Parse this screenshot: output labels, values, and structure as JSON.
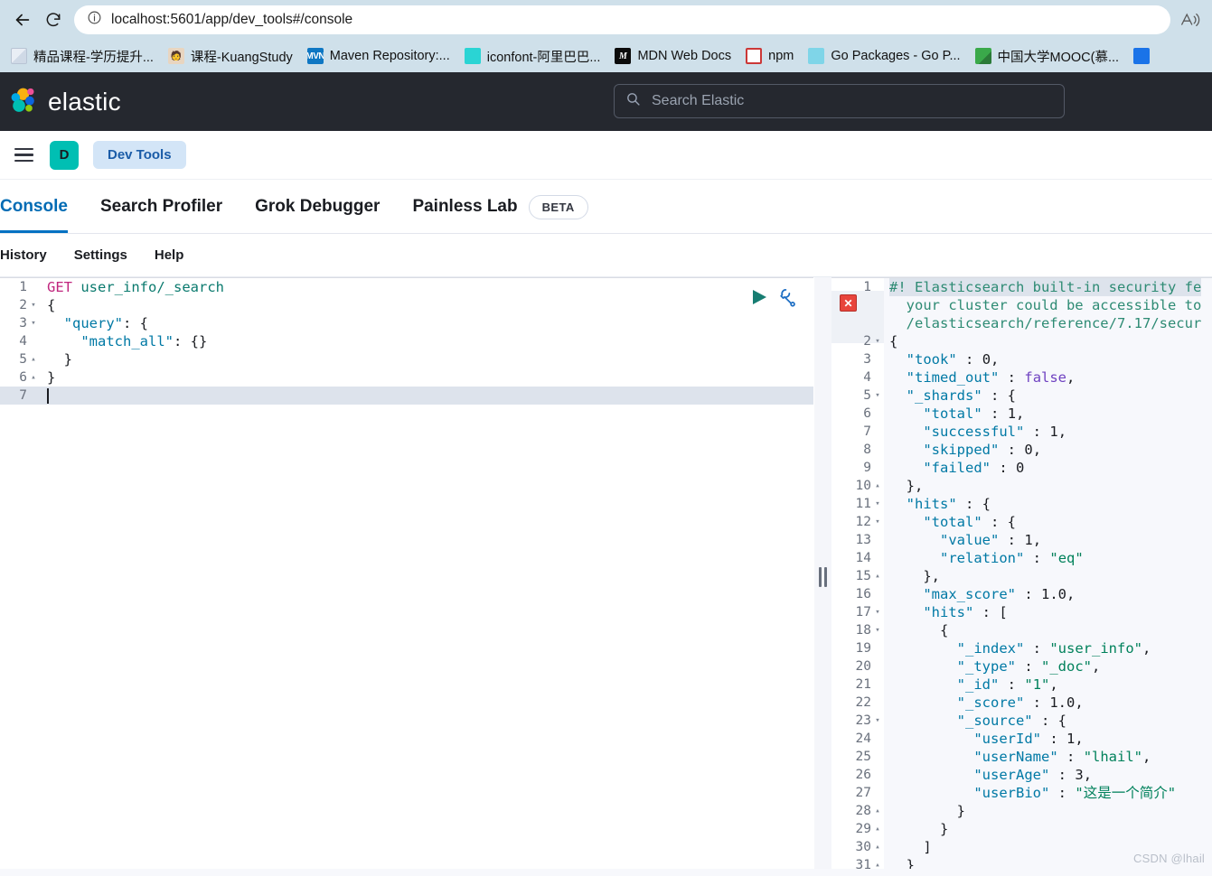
{
  "browser": {
    "back_label": "Back",
    "reload_label": "Reload",
    "url": "localhost:5601/app/dev_tools#/console",
    "read_aloud_label": "Read aloud",
    "bookmarks": [
      {
        "label": "精品课程-学历提升...",
        "icon": "document-icon",
        "style": "fav-doc"
      },
      {
        "label": "课程-KuangStudy",
        "icon": "avatar-icon",
        "style": "fav-kuang"
      },
      {
        "label": "Maven Repository:...",
        "icon": "maven-icon",
        "style": "fav-mvn",
        "glyph": "MVN"
      },
      {
        "label": "iconfont-阿里巴巴...",
        "icon": "iconfont-icon",
        "style": "fav-icon"
      },
      {
        "label": "MDN Web Docs",
        "icon": "mdn-icon",
        "style": "fav-mdn",
        "glyph": "M"
      },
      {
        "label": "npm",
        "icon": "npm-icon",
        "style": "fav-npm",
        "glyph": "n"
      },
      {
        "label": "Go Packages - Go P...",
        "icon": "go-icon",
        "style": "fav-go"
      },
      {
        "label": "中国大学MOOC(慕...",
        "icon": "mooc-icon",
        "style": "fav-mooc"
      },
      {
        "label": "",
        "icon": "generic-icon",
        "style": "fav-blue"
      }
    ]
  },
  "header": {
    "brand": "elastic",
    "search_placeholder": "Search Elastic",
    "search_icon": "search-icon"
  },
  "appnav": {
    "menu_icon": "hamburger-menu-icon",
    "avatar_initial": "D",
    "breadcrumb": "Dev Tools"
  },
  "tabs": [
    {
      "label": "Console",
      "active": true
    },
    {
      "label": "Search Profiler",
      "active": false
    },
    {
      "label": "Grok Debugger",
      "active": false
    },
    {
      "label": "Painless Lab",
      "active": false,
      "badge": "BETA"
    }
  ],
  "subnav": [
    {
      "label": "History"
    },
    {
      "label": "Settings"
    },
    {
      "label": "Help"
    }
  ],
  "editor": {
    "play_label": "Click to send request",
    "wrench_label": "Open documentation",
    "lines": [
      {
        "n": "1",
        "fold": "",
        "html": "<span class='k-method'>GET</span> <span class='k-url'>user_info/_search</span>",
        "current": false
      },
      {
        "n": "2",
        "fold": "▾",
        "html": "<span class='k-punct'>{</span>",
        "current": false
      },
      {
        "n": "3",
        "fold": "▾",
        "html": "  <span class='k-key'>\"query\"</span><span class='k-punct'>: {</span>",
        "current": false
      },
      {
        "n": "4",
        "fold": "",
        "html": "    <span class='k-key'>\"match_all\"</span><span class='k-punct'>: {}</span>",
        "current": false
      },
      {
        "n": "5",
        "fold": "▴",
        "html": "  <span class='k-punct'>}</span>",
        "current": false
      },
      {
        "n": "6",
        "fold": "▴",
        "html": "<span class='k-punct'>}</span>",
        "current": false
      },
      {
        "n": "7",
        "fold": "",
        "html": "<span class='caret'></span>",
        "current": true
      }
    ]
  },
  "response": {
    "error_marker": "error-x-icon",
    "lines": [
      {
        "n": "1",
        "fold": "",
        "html": "<span class='k-comment'>#! Elasticsearch built-in security fe</span>",
        "hl": true
      },
      {
        "n": "",
        "fold": "",
        "html": "  <span class='k-comment'>your cluster could be accessible to</span>",
        "hl": false
      },
      {
        "n": "",
        "fold": "",
        "html": "  <span class='k-comment'>/elasticsearch/reference/7.17/secur</span>",
        "hl": false
      },
      {
        "n": "2",
        "fold": "▾",
        "html": "<span class='k-punct'>{</span>",
        "hl": false
      },
      {
        "n": "3",
        "fold": "",
        "html": "  <span class='k-key'>\"took\"</span> <span class='k-punct'>:</span> <span class='k-num'>0</span><span class='k-punct'>,</span>",
        "hl": false
      },
      {
        "n": "4",
        "fold": "",
        "html": "  <span class='k-key'>\"timed_out\"</span> <span class='k-punct'>:</span> <span class='k-bool'>false</span><span class='k-punct'>,</span>",
        "hl": false
      },
      {
        "n": "5",
        "fold": "▾",
        "html": "  <span class='k-key'>\"_shards\"</span> <span class='k-punct'>: {</span>",
        "hl": false
      },
      {
        "n": "6",
        "fold": "",
        "html": "    <span class='k-key'>\"total\"</span> <span class='k-punct'>:</span> <span class='k-num'>1</span><span class='k-punct'>,</span>",
        "hl": false
      },
      {
        "n": "7",
        "fold": "",
        "html": "    <span class='k-key'>\"successful\"</span> <span class='k-punct'>:</span> <span class='k-num'>1</span><span class='k-punct'>,</span>",
        "hl": false
      },
      {
        "n": "8",
        "fold": "",
        "html": "    <span class='k-key'>\"skipped\"</span> <span class='k-punct'>:</span> <span class='k-num'>0</span><span class='k-punct'>,</span>",
        "hl": false
      },
      {
        "n": "9",
        "fold": "",
        "html": "    <span class='k-key'>\"failed\"</span> <span class='k-punct'>:</span> <span class='k-num'>0</span>",
        "hl": false
      },
      {
        "n": "10",
        "fold": "▴",
        "html": "  <span class='k-punct'>},</span>",
        "hl": false
      },
      {
        "n": "11",
        "fold": "▾",
        "html": "  <span class='k-key'>\"hits\"</span> <span class='k-punct'>: {</span>",
        "hl": false
      },
      {
        "n": "12",
        "fold": "▾",
        "html": "    <span class='k-key'>\"total\"</span> <span class='k-punct'>: {</span>",
        "hl": false
      },
      {
        "n": "13",
        "fold": "",
        "html": "      <span class='k-key'>\"value\"</span> <span class='k-punct'>:</span> <span class='k-num'>1</span><span class='k-punct'>,</span>",
        "hl": false
      },
      {
        "n": "14",
        "fold": "",
        "html": "      <span class='k-key'>\"relation\"</span> <span class='k-punct'>:</span> <span class='k-str'>\"eq\"</span>",
        "hl": false
      },
      {
        "n": "15",
        "fold": "▴",
        "html": "    <span class='k-punct'>},</span>",
        "hl": false
      },
      {
        "n": "16",
        "fold": "",
        "html": "    <span class='k-key'>\"max_score\"</span> <span class='k-punct'>:</span> <span class='k-num'>1.0</span><span class='k-punct'>,</span>",
        "hl": false
      },
      {
        "n": "17",
        "fold": "▾",
        "html": "    <span class='k-key'>\"hits\"</span> <span class='k-punct'>: [</span>",
        "hl": false
      },
      {
        "n": "18",
        "fold": "▾",
        "html": "      <span class='k-punct'>{</span>",
        "hl": false
      },
      {
        "n": "19",
        "fold": "",
        "html": "        <span class='k-key'>\"_index\"</span> <span class='k-punct'>:</span> <span class='k-str'>\"user_info\"</span><span class='k-punct'>,</span>",
        "hl": false
      },
      {
        "n": "20",
        "fold": "",
        "html": "        <span class='k-key'>\"_type\"</span> <span class='k-punct'>:</span> <span class='k-str'>\"_doc\"</span><span class='k-punct'>,</span>",
        "hl": false
      },
      {
        "n": "21",
        "fold": "",
        "html": "        <span class='k-key'>\"_id\"</span> <span class='k-punct'>:</span> <span class='k-str'>\"1\"</span><span class='k-punct'>,</span>",
        "hl": false
      },
      {
        "n": "22",
        "fold": "",
        "html": "        <span class='k-key'>\"_score\"</span> <span class='k-punct'>:</span> <span class='k-num'>1.0</span><span class='k-punct'>,</span>",
        "hl": false
      },
      {
        "n": "23",
        "fold": "▾",
        "html": "        <span class='k-key'>\"_source\"</span> <span class='k-punct'>: {</span>",
        "hl": false
      },
      {
        "n": "24",
        "fold": "",
        "html": "          <span class='k-key'>\"userId\"</span> <span class='k-punct'>:</span> <span class='k-num'>1</span><span class='k-punct'>,</span>",
        "hl": false
      },
      {
        "n": "25",
        "fold": "",
        "html": "          <span class='k-key'>\"userName\"</span> <span class='k-punct'>:</span> <span class='k-str'>\"lhail\"</span><span class='k-punct'>,</span>",
        "hl": false
      },
      {
        "n": "26",
        "fold": "",
        "html": "          <span class='k-key'>\"userAge\"</span> <span class='k-punct'>:</span> <span class='k-num'>3</span><span class='k-punct'>,</span>",
        "hl": false
      },
      {
        "n": "27",
        "fold": "",
        "html": "          <span class='k-key'>\"userBio\"</span> <span class='k-punct'>:</span> <span class='k-str'>\"这是一个简介\"</span>",
        "hl": false
      },
      {
        "n": "28",
        "fold": "▴",
        "html": "        <span class='k-punct'>}</span>",
        "hl": false
      },
      {
        "n": "29",
        "fold": "▴",
        "html": "      <span class='k-punct'>}</span>",
        "hl": false
      },
      {
        "n": "30",
        "fold": "▴",
        "html": "    <span class='k-punct'>]</span>",
        "hl": false
      },
      {
        "n": "31",
        "fold": "▴",
        "html": "  <span class='k-punct'>}</span>",
        "hl": false
      }
    ]
  },
  "watermark": "CSDN @lhail",
  "colors": {
    "elastic_header_bg": "#25282f",
    "accent_blue": "#0071c2",
    "avatar_teal": "#00bfb3",
    "error_red": "#e8453c",
    "browser_chrome": "#cfe0ea"
  }
}
